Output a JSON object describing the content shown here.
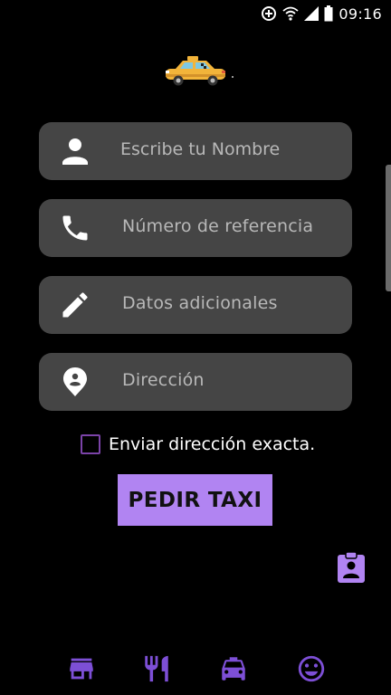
{
  "status_bar": {
    "time": "09:16"
  },
  "colors": {
    "background": "#000000",
    "field_bg": "#454545",
    "placeholder": "#b8b8b8",
    "accent": "#b184f2",
    "checkbox_border": "#7b43a8",
    "nav_icon": "#7d4fd6"
  },
  "logo": {
    "icon": "taxi-car-icon"
  },
  "form": {
    "fields": [
      {
        "icon": "person-icon",
        "placeholder": "Escribe tu Nombre",
        "value": ""
      },
      {
        "icon": "phone-icon",
        "placeholder": "Número de referencia"
      },
      {
        "icon": "pencil-icon",
        "placeholder": "Datos adicionales"
      },
      {
        "icon": "location-pin-icon",
        "placeholder": "Dirección"
      }
    ],
    "checkbox_label": "Enviar dirección exacta.",
    "checkbox_checked": false,
    "submit_label": "PEDIR TAXI"
  },
  "contact_button": {
    "icon": "contact-clipboard-icon"
  },
  "bottom_nav": [
    {
      "icon": "store-icon"
    },
    {
      "icon": "restaurant-icon"
    },
    {
      "icon": "taxi-icon"
    },
    {
      "icon": "smiley-icon"
    }
  ]
}
